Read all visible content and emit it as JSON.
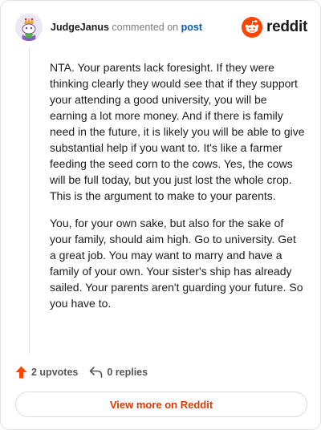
{
  "comment": {
    "author": "JudgeJanus",
    "action_text": "commented on",
    "post_link": "post",
    "paragraphs": [
      "NTA. Your parents lack foresight. If they were thinking clearly they would see that if they support your attending a good university, you will be earning a lot more money. And if there is family need in the future, it is likely you will be able to give substantial help if you want to. It's like a farmer feeding the seed corn to the cows. Yes, the cows will be full today, but you just lost the whole crop. This is the argument to make to your parents.",
      "You, for your own sake, but also for the sake of your family, should aim high. Go to university. Get a great job. You may want to marry and have a family of your own. Your sister's ship has already sailed. Your parents aren't guarding your future. So you have to."
    ]
  },
  "brand": {
    "wordmark": "reddit",
    "accent_color": "#ff4500"
  },
  "actions": {
    "upvotes": "2 upvotes",
    "replies": "0 replies"
  },
  "footer": {
    "view_more_label": "View more on Reddit"
  },
  "icons": {
    "avatar": "snoo-avatar",
    "logo": "reddit-logo-icon",
    "upvote": "upvote-arrow-icon",
    "reply": "reply-arrow-icon"
  }
}
